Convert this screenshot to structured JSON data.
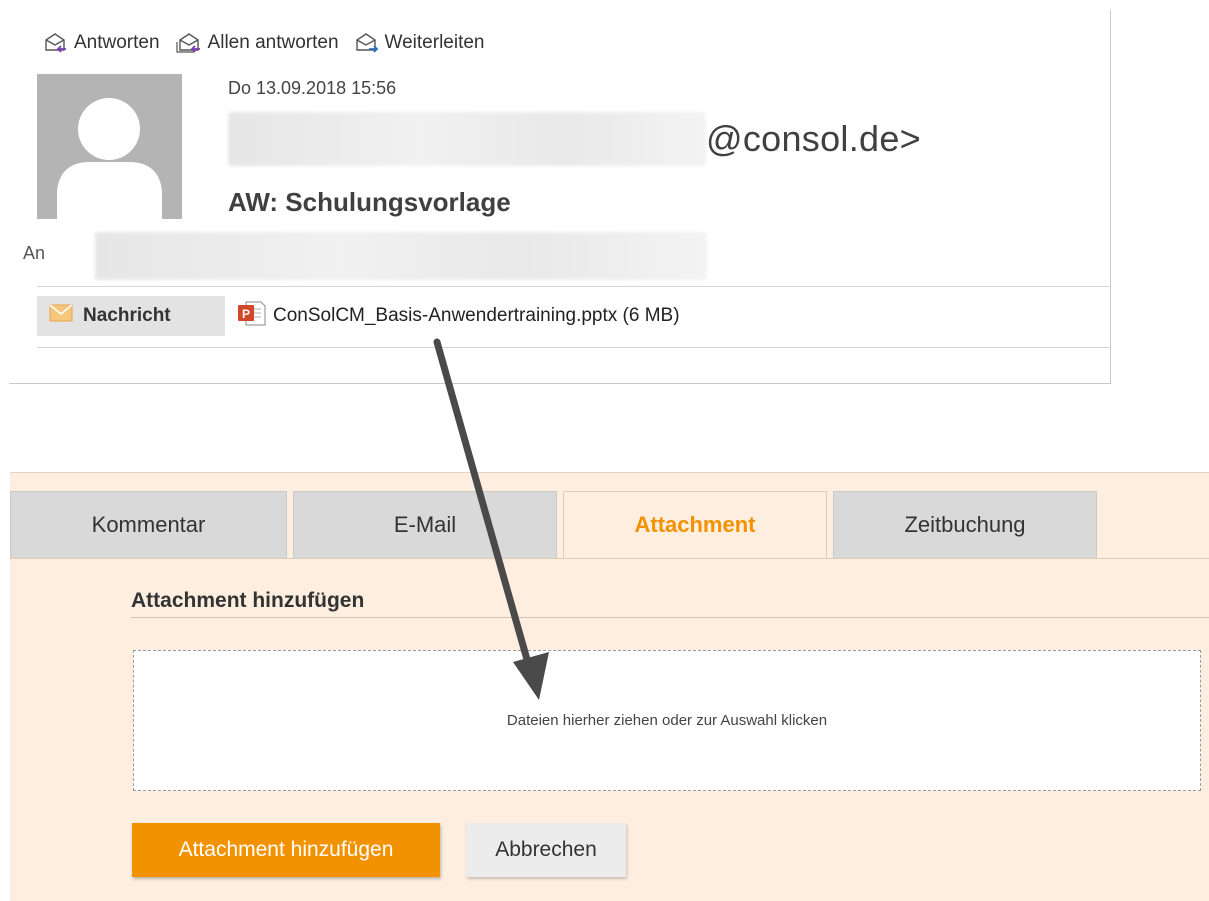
{
  "mail": {
    "actions": {
      "reply": "Antworten",
      "reply_all": "Allen antworten",
      "forward": "Weiterleiten"
    },
    "date": "Do 13.09.2018 15:56",
    "sender_domain": "@consol.de>",
    "subject": "AW: Schulungsvorlage",
    "to_label": "An",
    "message_tab": "Nachricht",
    "attachment_file": "ConSolCM_Basis-Anwendertraining.pptx (6 MB)"
  },
  "ticket": {
    "tabs": [
      "Kommentar",
      "E-Mail",
      "Attachment",
      "Zeitbuchung"
    ],
    "active_tab": "Attachment",
    "section_title": "Attachment hinzufügen",
    "dropzone_text": "Dateien hierher ziehen oder zur Auswahl klicken",
    "add_button": "Attachment hinzufügen",
    "cancel_button": "Abbrechen"
  },
  "colors": {
    "accent": "#f39200",
    "panel_bg": "#fdeee0",
    "arrow": "#4a4a4a"
  }
}
